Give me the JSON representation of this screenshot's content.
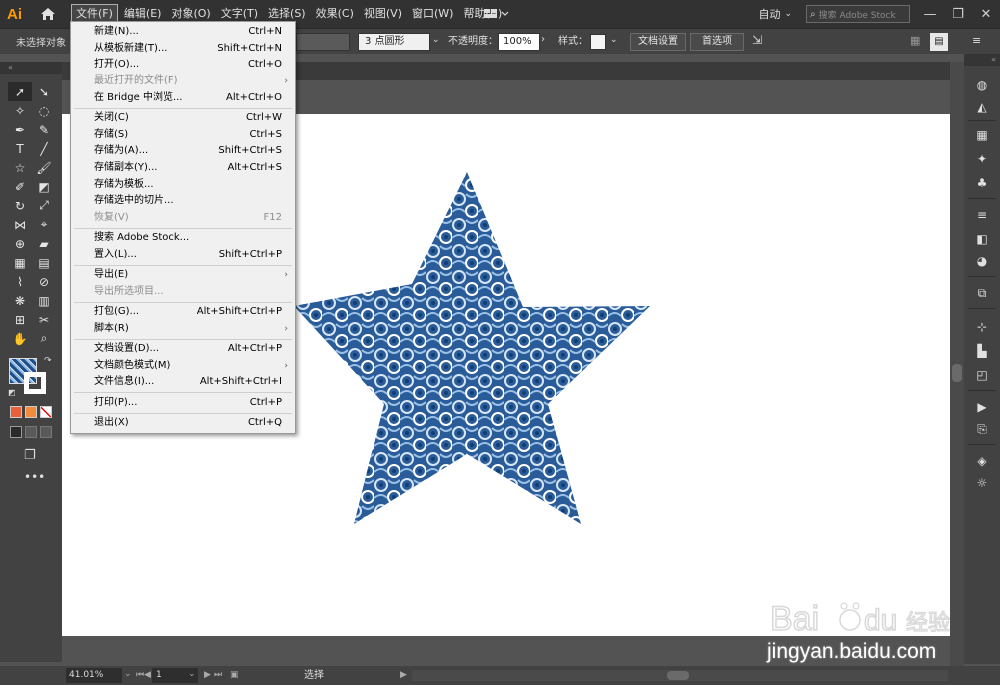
{
  "app": {
    "logo": "Ai"
  },
  "menubar": {
    "items": [
      "文件(F)",
      "编辑(E)",
      "对象(O)",
      "文字(T)",
      "选择(S)",
      "效果(C)",
      "视图(V)",
      "窗口(W)",
      "帮助(H)"
    ],
    "workspace": "自动",
    "search_placeholder": "搜索 Adobe Stock"
  },
  "controlbar": {
    "selection_status": "未选择对象",
    "brush": "3 点圆形",
    "opacity_label": "不透明度：",
    "opacity_value": "100%",
    "style_label": "样式：",
    "doc_settings": "文档设置",
    "preferences": "首选项"
  },
  "file_menu": {
    "items": [
      {
        "label": "新建(N)...",
        "shortcut": "Ctrl+N",
        "disabled": false
      },
      {
        "label": "从模板新建(T)...",
        "shortcut": "Shift+Ctrl+N",
        "disabled": false
      },
      {
        "label": "打开(O)...",
        "shortcut": "Ctrl+O",
        "disabled": false
      },
      {
        "label": "最近打开的文件(F)",
        "shortcut": "",
        "disabled": true,
        "submenu": true
      },
      {
        "label": "在 Bridge 中浏览...",
        "shortcut": "Alt+Ctrl+O",
        "disabled": false
      },
      {
        "label": "关闭(C)",
        "shortcut": "Ctrl+W",
        "disabled": false
      },
      {
        "label": "存储(S)",
        "shortcut": "Ctrl+S",
        "disabled": false
      },
      {
        "label": "存储为(A)...",
        "shortcut": "Shift+Ctrl+S",
        "disabled": false
      },
      {
        "label": "存储副本(Y)...",
        "shortcut": "Alt+Ctrl+S",
        "disabled": false
      },
      {
        "label": "存储为模板...",
        "shortcut": "",
        "disabled": false
      },
      {
        "label": "存储选中的切片...",
        "shortcut": "",
        "disabled": false
      },
      {
        "label": "恢复(V)",
        "shortcut": "F12",
        "disabled": true
      },
      {
        "label": "搜索 Adobe Stock...",
        "shortcut": "",
        "disabled": false
      },
      {
        "label": "置入(L)...",
        "shortcut": "Shift+Ctrl+P",
        "disabled": false
      },
      {
        "label": "导出(E)",
        "shortcut": "",
        "disabled": false,
        "submenu": true
      },
      {
        "label": "导出所选项目...",
        "shortcut": "",
        "disabled": true
      },
      {
        "label": "打包(G)...",
        "shortcut": "Alt+Shift+Ctrl+P",
        "disabled": false
      },
      {
        "label": "脚本(R)",
        "shortcut": "",
        "disabled": false,
        "submenu": true
      },
      {
        "label": "文档设置(D)...",
        "shortcut": "Alt+Ctrl+P",
        "disabled": false
      },
      {
        "label": "文档颜色模式(M)",
        "shortcut": "",
        "disabled": false,
        "submenu": true
      },
      {
        "label": "文件信息(I)...",
        "shortcut": "Alt+Shift+Ctrl+I",
        "disabled": false
      },
      {
        "label": "打印(P)...",
        "shortcut": "Ctrl+P",
        "disabled": false
      },
      {
        "label": "退出(X)",
        "shortcut": "Ctrl+Q",
        "disabled": false
      }
    ]
  },
  "statusbar": {
    "zoom": "41.01%",
    "artboard": "1",
    "tool": "选择"
  },
  "watermark": {
    "text": "jingyan.baidu.com"
  },
  "colors": {
    "menubar": "#323232",
    "panel": "#424242",
    "canvas": "#535353",
    "pattern_dark": "#1e4f8c",
    "pattern_light": "#8fb7e0"
  }
}
